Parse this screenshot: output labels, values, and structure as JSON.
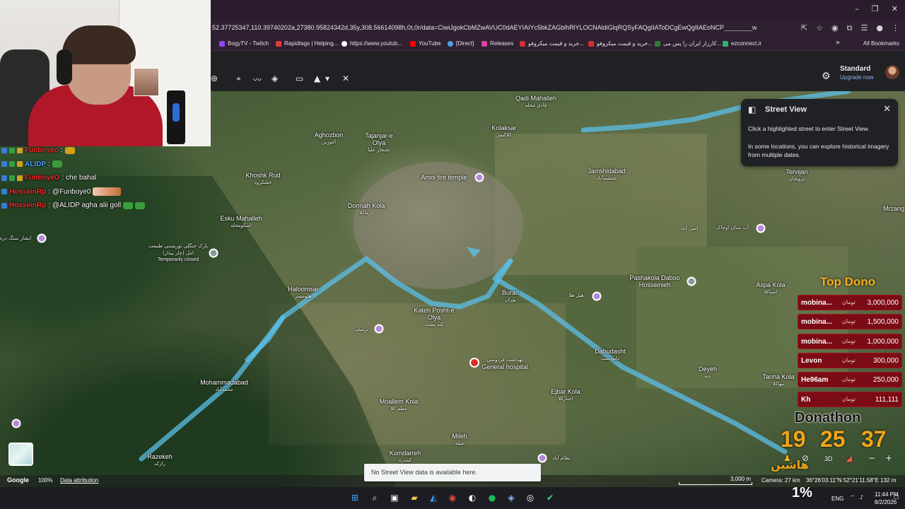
{
  "browser": {
    "url": "52.37725347,110.39740202a,27380.95824342d,35y,308.56614098h,0t,0r/data=CiwiJgokCbMZwAVUC0dAEYIAIYc5bkZAGblhRlYLOCNAldiGlqRQSyFAQgIIAToDCgEwQgIIAEoNCP________wEQAA",
    "bookmarks": [
      {
        "label": "BogyTV - Twitch",
        "color": "#9146ff"
      },
      {
        "label": "Rapidtags | Helping...",
        "color": "#e23b3b"
      },
      {
        "label": "https://www.youtub...",
        "color": "#ffffff"
      },
      {
        "label": "YouTube",
        "color": "#ff0000"
      },
      {
        "label": "[Direct]",
        "color": "#4aa3df"
      },
      {
        "label": "Releases",
        "color": "#e040a0"
      },
      {
        "label": "خرید و قیمت میکروفو...",
        "color": "#d03030"
      },
      {
        "label": "خرید و قیمت میکروفو...",
        "color": "#d03030"
      },
      {
        "label": "کارزار ایران را پس می...",
        "color": "#2e7d32"
      },
      {
        "label": "ezconnect.ir",
        "color": "#2bb673"
      }
    ],
    "all_bookmarks": "All Bookmarks"
  },
  "earth": {
    "plan_name": "Standard",
    "plan_action": "Upgrade now"
  },
  "chat": [
    {
      "name": "Funboyeo",
      "name_color": "#ff2a2a",
      "message": ":",
      "badges": [
        "#3a7bd5",
        "#2ea043",
        "#d4a017"
      ]
    },
    {
      "name": "ALIDP",
      "name_color": "#4d9fff",
      "message": ":",
      "badges": [
        "#3a7bd5",
        "#2ea043",
        "#d4a017"
      ],
      "emote": true
    },
    {
      "name": "FunboyeO",
      "name_color": "#ff2a2a",
      "message": ": che bahal",
      "badges": [
        "#3a7bd5",
        "#2ea043",
        "#d4a017"
      ]
    },
    {
      "name": "HosseinRp",
      "name_color": "#ff2a2a",
      "message": ": @Funboye0",
      "badges": [
        "#3a7bd5"
      ],
      "emote_wide": true
    },
    {
      "name": "HosseinRp",
      "name_color": "#ff2a2a",
      "message": ": @ALIDP  agha alii goll",
      "badges": [
        "#3a7bd5"
      ],
      "emote": true
    }
  ],
  "map": {
    "places": [
      {
        "en": "Qadi Mahalleh",
        "fa": "قادی محله"
      },
      {
        "en": "Aghozbon",
        "fa": "آغوزبن"
      },
      {
        "en": "Tajanjar-e Olya",
        "fa": "تجنجار علیا"
      },
      {
        "en": "Kolaksar",
        "fa": "کلاکسر"
      },
      {
        "en": "Khoshk Rud",
        "fa": "خشکرود"
      },
      {
        "en": "Amol fire temple",
        "fa": ""
      },
      {
        "en": "Jamshidabad",
        "fa": "جمشیدآباد"
      },
      {
        "en": "Tervijan",
        "fa": "ترویجان"
      },
      {
        "en": "Mrzang",
        "fa": ""
      },
      {
        "en": "Esku Mahalleh",
        "fa": "اسکومحله"
      },
      {
        "en": "Dormah Kola",
        "fa": "درماکلا"
      },
      {
        "en": "Haloomsar",
        "fa": "هلومسر"
      },
      {
        "en": "Buran",
        "fa": "بوران"
      },
      {
        "en": "Kateh Posht-e Olya",
        "fa": "کته پشت"
      },
      {
        "en": "Pashakola Daboo Hosseinieh",
        "fa": ""
      },
      {
        "en": "Aspa Kola",
        "fa": "اسپاکلا"
      },
      {
        "en": "Dabudasht",
        "fa": "دابودشت"
      },
      {
        "en": "Deyeh",
        "fa": "دیه"
      },
      {
        "en": "Tanha Kola",
        "fa": "تنهاکلا"
      },
      {
        "en": "Mohammadabad",
        "fa": "محمدآباد"
      },
      {
        "en": "Moallem Kola",
        "fa": "معلم کلا"
      },
      {
        "en": "Ejbar Kola",
        "fa": "اجبارکلا"
      },
      {
        "en": "Mileh",
        "fa": "میله"
      },
      {
        "en": "Komdarreh",
        "fa": "کمدره"
      },
      {
        "en": "Razekeh",
        "fa": "رازکه"
      },
      {
        "en": "General hospital",
        "fa": "بهداشت فردوسی"
      },
      {
        "en": "Temporarily closed",
        "fa": "پارک جنگلی توریستی طبیعت امل (چار بیدار)"
      },
      {
        "en": "",
        "fa": "آب بندان اوجاک"
      },
      {
        "en": "",
        "fa": "امین آباد"
      },
      {
        "en": "",
        "fa": "هتل هلا"
      },
      {
        "en": "",
        "fa": "نظام آباد"
      },
      {
        "en": "",
        "fa": "ابشار سنگ دره"
      },
      {
        "en": "",
        "fa": "نرمیلی"
      }
    ]
  },
  "street_view": {
    "title": "Street View",
    "line1": "Click a highlighted street to enter Street View.",
    "line2": "In some locations, you can explore historical imagery from multiple dates."
  },
  "donations": {
    "title": "Top Dono",
    "currency": "تومان",
    "rows": [
      {
        "name": "mobina...",
        "amount": "3,000,000"
      },
      {
        "name": "mobina...",
        "amount": "1,500,000"
      },
      {
        "name": "mobina...",
        "amount": "1,000,000"
      },
      {
        "name": "Levon",
        "amount": "300,000"
      },
      {
        "name": "He96am",
        "amount": "250,000"
      },
      {
        "name": "Kh",
        "amount": "111,111"
      }
    ],
    "donathon": "Donathon",
    "timer": [
      "19",
      "25",
      "37"
    ],
    "stamp": "هاشین"
  },
  "status": {
    "google": "Google",
    "zoom": "100%",
    "attribution": "Data attribution",
    "scale": "3,000 m",
    "camera": "Camera: 27 km",
    "coords": "36°26'03.11\"N 52°21'11.58\"E 132 m",
    "toast": "No Street View data is available here.",
    "view_3d": "3D"
  },
  "taskbar": {
    "lang": "ENG",
    "time": "11:44 PM",
    "date": "8/2/2026",
    "percent": "1%"
  }
}
